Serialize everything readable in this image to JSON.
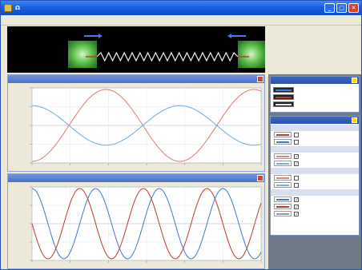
{
  "window": {
    "title": "Ω",
    "minimize_glyph": "_",
    "maximize_glyph": "□",
    "close_glyph": "✕"
  },
  "menu": {
    "items": [
      {
        "label": ""
      },
      {
        "label": ""
      },
      {
        "label": ""
      },
      {
        "label": ""
      },
      {
        "label": ""
      },
      {
        "label": ""
      }
    ]
  },
  "stage": {
    "arrow_left_icon": "arrow-right-icon",
    "arrow_right_icon": "arrow-left-icon",
    "spring_color": "#f2f2f2",
    "block_color": "#3fae3f",
    "arrow_color": "#3d7fe8"
  },
  "plots": [
    {
      "title": "",
      "chart_data": {
        "type": "line",
        "title": "",
        "xlabel": "",
        "ylabel": "",
        "grid": true,
        "series": [
          {
            "color": "#e07a6a",
            "amplitude": 1.0,
            "cycles": 1.55,
            "phase": 3.14
          },
          {
            "color": "#6aaad8",
            "amplitude": 0.55,
            "cycles": 1.55,
            "phase": 0.0
          }
        ]
      }
    },
    {
      "title": "",
      "chart_data": {
        "type": "line",
        "title": "",
        "xlabel": "",
        "ylabel": "",
        "grid": true,
        "series": [
          {
            "color": "#c0392b",
            "amplitude": 1.0,
            "cycles": 3.6,
            "phase": 1.57
          },
          {
            "color": "#3b79c4",
            "amplitude": 1.0,
            "cycles": 3.6,
            "phase": 0.0
          }
        ]
      }
    }
  ],
  "side": {
    "legend_panel": {
      "title": "",
      "rows": [
        {
          "label": "",
          "color": "#3d7fe8"
        },
        {
          "label": "",
          "color": "#c0392b"
        },
        {
          "label": "",
          "color": "#e8e8e8"
        }
      ]
    },
    "options_panel": {
      "title": "",
      "groups": [
        {
          "title": "",
          "rows": [
            {
              "label": "",
              "checked": false,
              "color": "#c0392b"
            },
            {
              "label": "",
              "checked": false,
              "color": "#3b79c4"
            }
          ]
        },
        {
          "title": "",
          "rows": [
            {
              "label": "",
              "checked": true,
              "color": "#d48a7a"
            },
            {
              "label": "",
              "checked": true,
              "color": "#7ab0d8"
            }
          ]
        },
        {
          "title": "",
          "rows": [
            {
              "label": "",
              "checked": false,
              "color": "#d48a7a"
            },
            {
              "label": "",
              "checked": false,
              "color": "#7ab0d8"
            }
          ]
        },
        {
          "title": "",
          "rows": [
            {
              "label": "",
              "checked": true,
              "color": "#3b79c4"
            },
            {
              "label": "",
              "checked": true,
              "color": "#c0392b"
            },
            {
              "label": "",
              "checked": true,
              "color": "#999999"
            }
          ]
        }
      ]
    }
  }
}
